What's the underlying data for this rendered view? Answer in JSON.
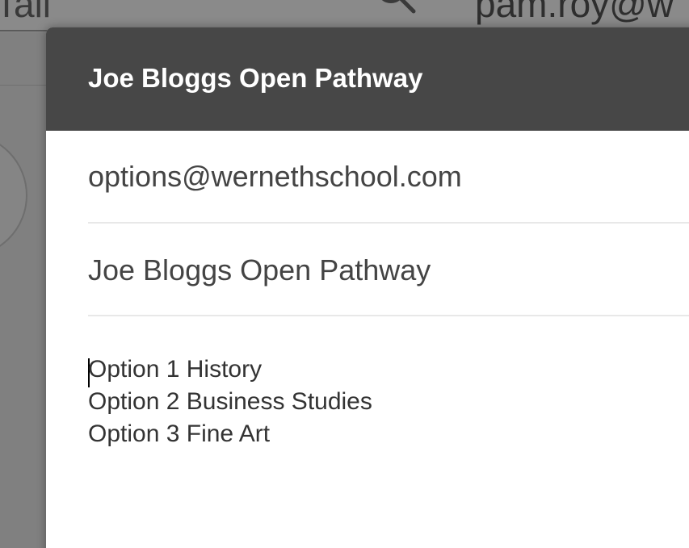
{
  "background": {
    "left_text": "Tall",
    "email_text": "pam.roy@w"
  },
  "dialog": {
    "title": "Joe Bloggs Open Pathway",
    "to_field": "options@wernethschool.com",
    "subject_field": "Joe Bloggs Open Pathway",
    "body_lines": [
      "Option 1 History",
      "Option 2 Business Studies",
      "Option 3 Fine Art"
    ]
  },
  "colors": {
    "header_bg": "#474747",
    "overlay_bg": "#808080",
    "dialog_bg": "#ffffff"
  }
}
